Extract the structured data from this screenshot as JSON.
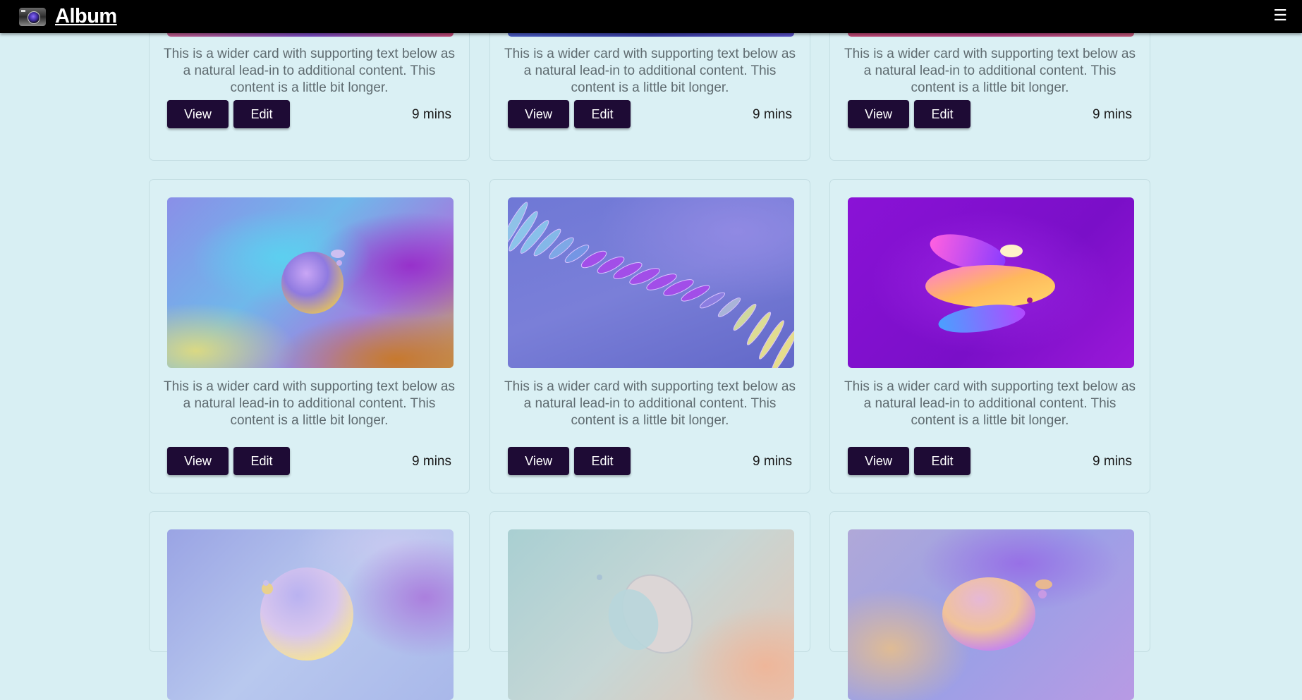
{
  "navbar": {
    "brand": "Album",
    "menu_glyph": "☰",
    "logo_icon": "camera-icon"
  },
  "cards": [
    {
      "text": "This is a wider card with supporting text below as a natural lead-in to additional content. This content is a little bit longer.",
      "view": "View",
      "edit": "Edit",
      "time": "9 mins"
    },
    {
      "text": "This is a wider card with supporting text below as a natural lead-in to additional content. This content is a little bit longer.",
      "view": "View",
      "edit": "Edit",
      "time": "9 mins"
    },
    {
      "text": "This is a wider card with supporting text below as a natural lead-in to additional content. This content is a little bit longer.",
      "view": "View",
      "edit": "Edit",
      "time": "9 mins"
    },
    {
      "text": "This is a wider card with supporting text below as a natural lead-in to additional content. This content is a little bit longer.",
      "view": "View",
      "edit": "Edit",
      "time": "9 mins"
    },
    {
      "text": "This is a wider card with supporting text below as a natural lead-in to additional content. This content is a little bit longer.",
      "view": "View",
      "edit": "Edit",
      "time": "9 mins"
    },
    {
      "text": "This is a wider card with supporting text below as a natural lead-in to additional content. This content is a little bit longer.",
      "view": "View",
      "edit": "Edit",
      "time": "9 mins"
    }
  ],
  "colors": {
    "background": "#d8eff3",
    "button": "#1e0b35",
    "navbar": "#000000"
  }
}
